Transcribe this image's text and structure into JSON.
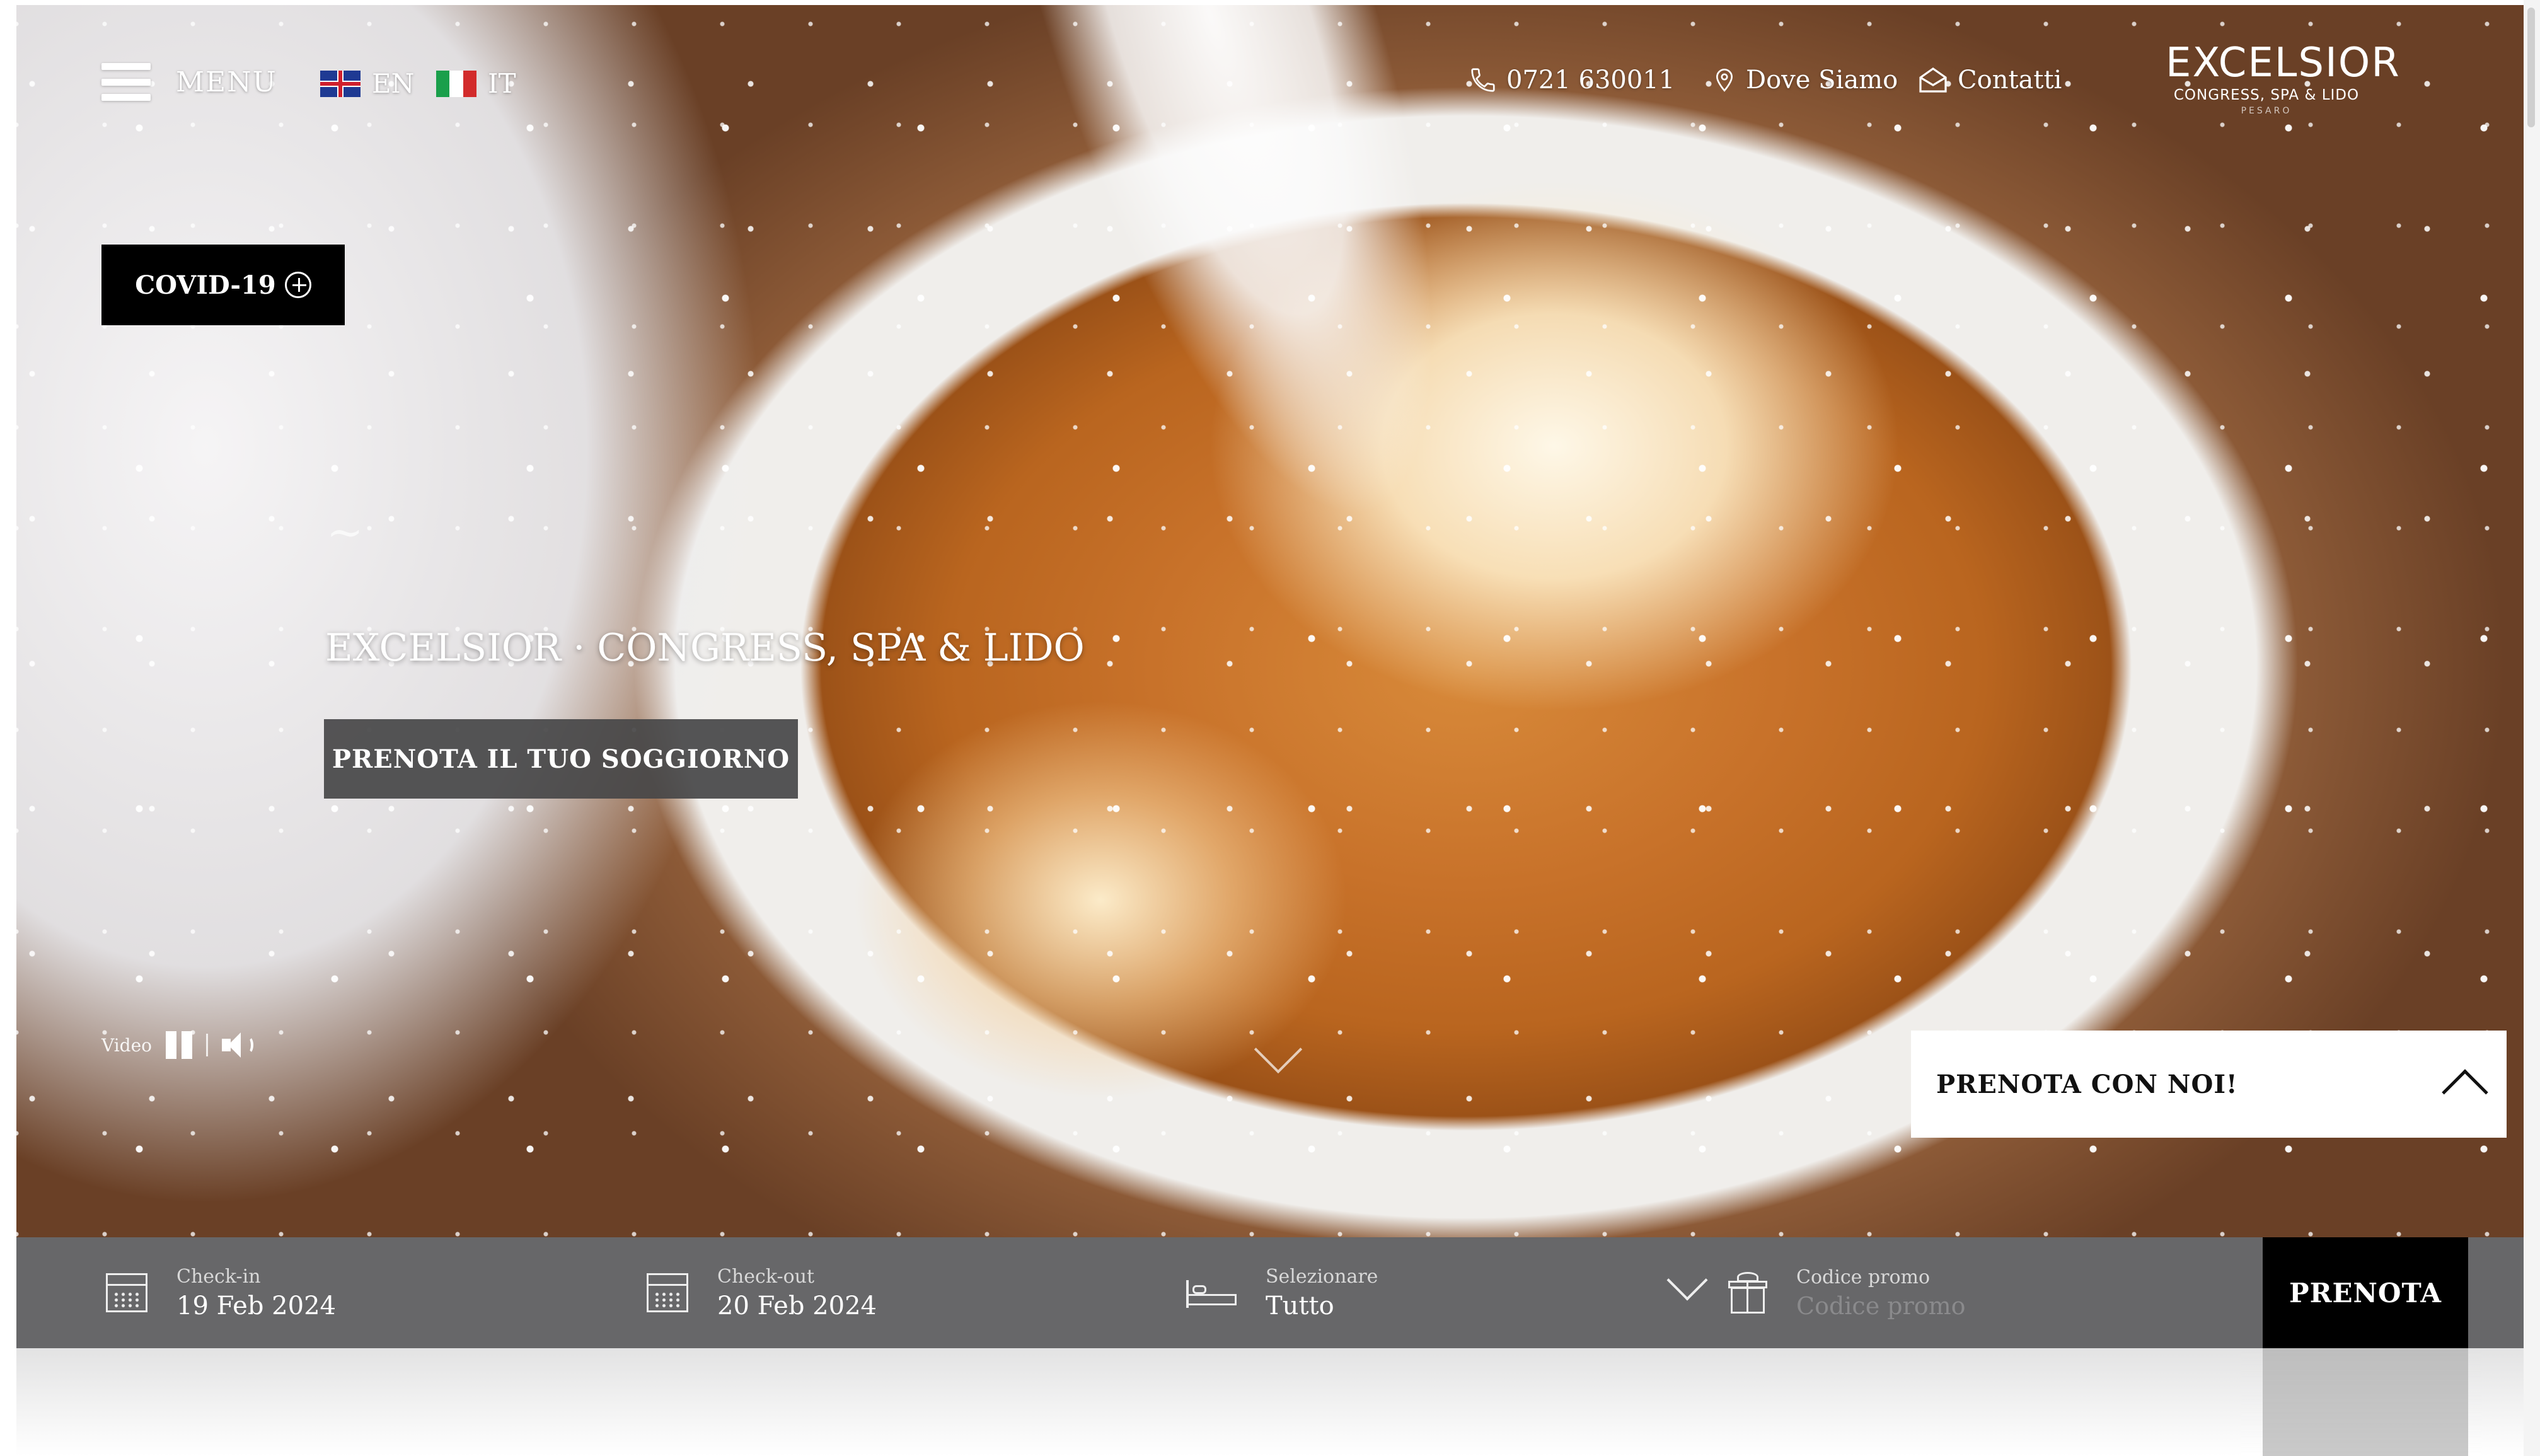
{
  "header": {
    "menu_label": "MENU",
    "languages": [
      {
        "code": "EN",
        "flag": "uk-flag-icon"
      },
      {
        "code": "IT",
        "flag": "italy-flag-icon"
      }
    ],
    "phone": "0721 630011",
    "where_label": "Dove Siamo",
    "contact_label": "Contatti",
    "logo": {
      "main": "EXCELSIOR",
      "sub": "CONGRESS, SPA & LIDO",
      "city": "PESARO"
    }
  },
  "covid": {
    "label": "COVID-19"
  },
  "hero": {
    "tilde": "~",
    "title": "EXCELSIOR · CONGRESS, SPA & LIDO",
    "cta": "PRENOTA IL TUO SOGGIORNO"
  },
  "video": {
    "label": "Video"
  },
  "book_panel": {
    "title": "PRENOTA CON NOI!"
  },
  "booking": {
    "checkin": {
      "label": "Check-in",
      "value": "19 Feb 2024"
    },
    "checkout": {
      "label": "Check-out",
      "value": "20 Feb 2024"
    },
    "select": {
      "label": "Selezionare",
      "value": "Tutto"
    },
    "promo": {
      "label": "Codice promo",
      "placeholder": "Codice promo"
    },
    "submit": "PRENOTA"
  },
  "colors": {
    "bar": "#626264",
    "button": "#000000",
    "hero_button": "#464648",
    "text": "#ffffff"
  }
}
